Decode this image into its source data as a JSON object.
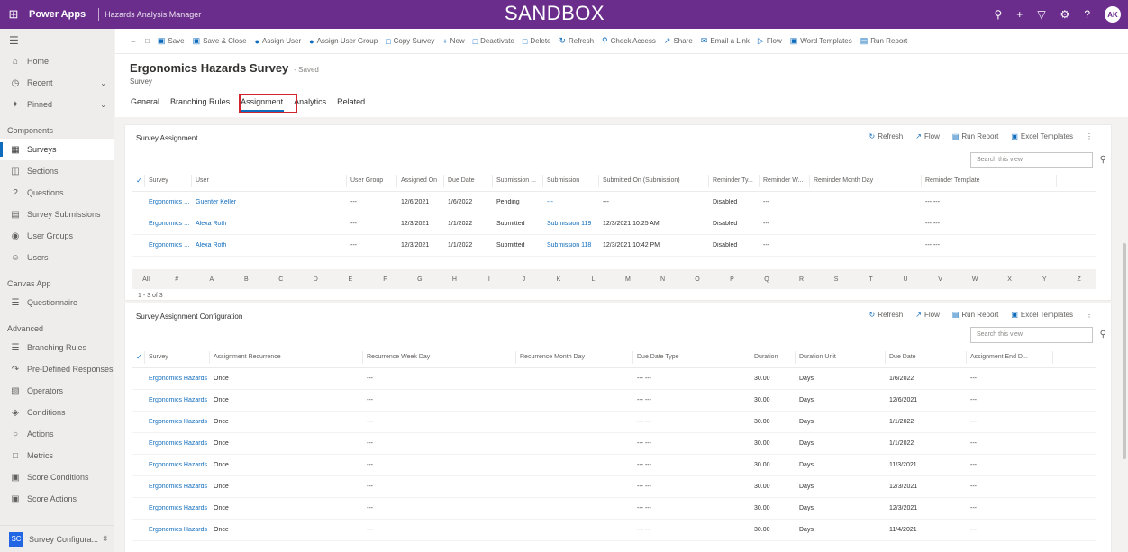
{
  "topbar": {
    "app_name": "Power Apps",
    "env_name": "Hazards Analysis Manager",
    "sandbox": "SANDBOX",
    "avatar": "AK"
  },
  "sidebar": {
    "items_top": [
      {
        "label": "Home",
        "icon": "home-icon"
      },
      {
        "label": "Recent",
        "icon": "clock-icon",
        "chevron": true
      },
      {
        "label": "Pinned",
        "icon": "pin-icon",
        "chevron": true
      }
    ],
    "groups": [
      {
        "title": "Components",
        "items": [
          {
            "label": "Surveys",
            "icon": "survey-icon",
            "active": true
          },
          {
            "label": "Sections",
            "icon": "sections-icon"
          },
          {
            "label": "Questions",
            "icon": "question-icon"
          },
          {
            "label": "Survey Submissions",
            "icon": "submission-icon"
          },
          {
            "label": "User Groups",
            "icon": "group-icon"
          },
          {
            "label": "Users",
            "icon": "user-icon"
          }
        ]
      },
      {
        "title": "Canvas App",
        "items": [
          {
            "label": "Questionnaire",
            "icon": "questionnaire-icon"
          }
        ]
      },
      {
        "title": "Advanced",
        "items": [
          {
            "label": "Branching Rules",
            "icon": "branch-icon"
          },
          {
            "label": "Pre-Defined Responses",
            "icon": "response-icon"
          },
          {
            "label": "Operators",
            "icon": "operator-icon"
          },
          {
            "label": "Conditions",
            "icon": "condition-icon"
          },
          {
            "label": "Actions",
            "icon": "action-icon"
          },
          {
            "label": "Metrics",
            "icon": "metric-icon"
          },
          {
            "label": "Score Conditions",
            "icon": "score-icon"
          },
          {
            "label": "Score Actions",
            "icon": "score-action-icon"
          }
        ]
      }
    ],
    "area_badge": "SC",
    "area_label": "Survey Configura..."
  },
  "commands": [
    {
      "label": "Save",
      "icon": "save-icon"
    },
    {
      "label": "Save & Close",
      "icon": "save-close-icon"
    },
    {
      "label": "Assign User",
      "icon": "assign-user-icon"
    },
    {
      "label": "Assign User Group",
      "icon": "assign-group-icon"
    },
    {
      "label": "Copy Survey",
      "icon": "copy-icon"
    },
    {
      "label": "New",
      "icon": "add-icon"
    },
    {
      "label": "Deactivate",
      "icon": "deactivate-icon"
    },
    {
      "label": "Delete",
      "icon": "delete-icon"
    },
    {
      "label": "Refresh",
      "icon": "refresh-icon"
    },
    {
      "label": "Check Access",
      "icon": "check-access-icon"
    },
    {
      "label": "Share",
      "icon": "share-icon"
    },
    {
      "label": "Email a Link",
      "icon": "email-icon"
    },
    {
      "label": "Flow",
      "icon": "flow-icon"
    },
    {
      "label": "Word Templates",
      "icon": "word-icon"
    },
    {
      "label": "Run Report",
      "icon": "report-icon"
    }
  ],
  "record": {
    "title": "Ergonomics Hazards Survey",
    "saved": "- Saved",
    "entity": "Survey"
  },
  "tabs": [
    "General",
    "Branching Rules",
    "Assignment",
    "Analytics",
    "Related"
  ],
  "panel1": {
    "title": "Survey Assignment",
    "actions": [
      "Refresh",
      "Flow",
      "Run Report",
      "Excel Templates"
    ],
    "search_placeholder": "Search this view",
    "columns": [
      "Survey",
      "User",
      "User Group",
      "Assigned On",
      "Due Date",
      "Submission ...",
      "Submission",
      "Submitted On (Submission)",
      "Reminder Ty...",
      "Reminder W...",
      "Reminder Month Day",
      "Reminder Template"
    ],
    "rows": [
      [
        "Ergonomics Haz",
        "Guenter Keller",
        "---",
        "12/6/2021",
        "1/6/2022",
        "Pending",
        "---",
        "---",
        "Disabled",
        "---",
        "",
        "--- ---"
      ],
      [
        "Ergonomics Haz",
        "Alexa Roth",
        "---",
        "12/3/2021",
        "1/1/2022",
        "Submitted",
        "Submission 119",
        "12/3/2021 10:25 AM",
        "Disabled",
        "---",
        "",
        "--- ---"
      ],
      [
        "Ergonomics Haz",
        "Alexa Roth",
        "---",
        "12/3/2021",
        "1/1/2022",
        "Submitted",
        "Submission 118",
        "12/3/2021 10:42 PM",
        "Disabled",
        "---",
        "",
        "--- ---"
      ]
    ],
    "jump": [
      "All",
      "#",
      "A",
      "B",
      "C",
      "D",
      "E",
      "F",
      "G",
      "H",
      "I",
      "J",
      "K",
      "L",
      "M",
      "N",
      "O",
      "P",
      "Q",
      "R",
      "S",
      "T",
      "U",
      "V",
      "W",
      "X",
      "Y",
      "Z"
    ],
    "pager": "1 - 3 of 3"
  },
  "panel2": {
    "title": "Survey Assignment Configuration",
    "actions": [
      "Refresh",
      "Flow",
      "Run Report",
      "Excel Templates"
    ],
    "search_placeholder": "Search this view",
    "columns": [
      "Survey",
      "Assignment Recurrence",
      "Recurrence Week Day",
      "Recurrence Month Day",
      "Due Date Type",
      "Duration",
      "Duration Unit",
      "Due Date",
      "Assignment End D..."
    ],
    "rows": [
      [
        "Ergonomics Hazards",
        "Once",
        "---",
        "",
        "--- ---",
        "30.00",
        "Days",
        "1/6/2022",
        "---"
      ],
      [
        "Ergonomics Hazards",
        "Once",
        "---",
        "",
        "--- ---",
        "30.00",
        "Days",
        "12/6/2021",
        "---"
      ],
      [
        "Ergonomics Hazards",
        "Once",
        "---",
        "",
        "--- ---",
        "30.00",
        "Days",
        "1/1/2022",
        "---"
      ],
      [
        "Ergonomics Hazards",
        "Once",
        "---",
        "",
        "--- ---",
        "30.00",
        "Days",
        "1/1/2022",
        "---"
      ],
      [
        "Ergonomics Hazards",
        "Once",
        "---",
        "",
        "--- ---",
        "30.00",
        "Days",
        "11/3/2021",
        "---"
      ],
      [
        "Ergonomics Hazards",
        "Once",
        "---",
        "",
        "--- ---",
        "30.00",
        "Days",
        "12/3/2021",
        "---"
      ],
      [
        "Ergonomics Hazards",
        "Once",
        "---",
        "",
        "--- ---",
        "30.00",
        "Days",
        "12/3/2021",
        "---"
      ],
      [
        "Ergonomics Hazards",
        "Once",
        "---",
        "",
        "--- ---",
        "30.00",
        "Days",
        "11/4/2021",
        "---"
      ]
    ]
  },
  "colors": {
    "brand": "#6b2d8c",
    "accent": "#0f6cbd",
    "highlight": "#d1242f"
  }
}
